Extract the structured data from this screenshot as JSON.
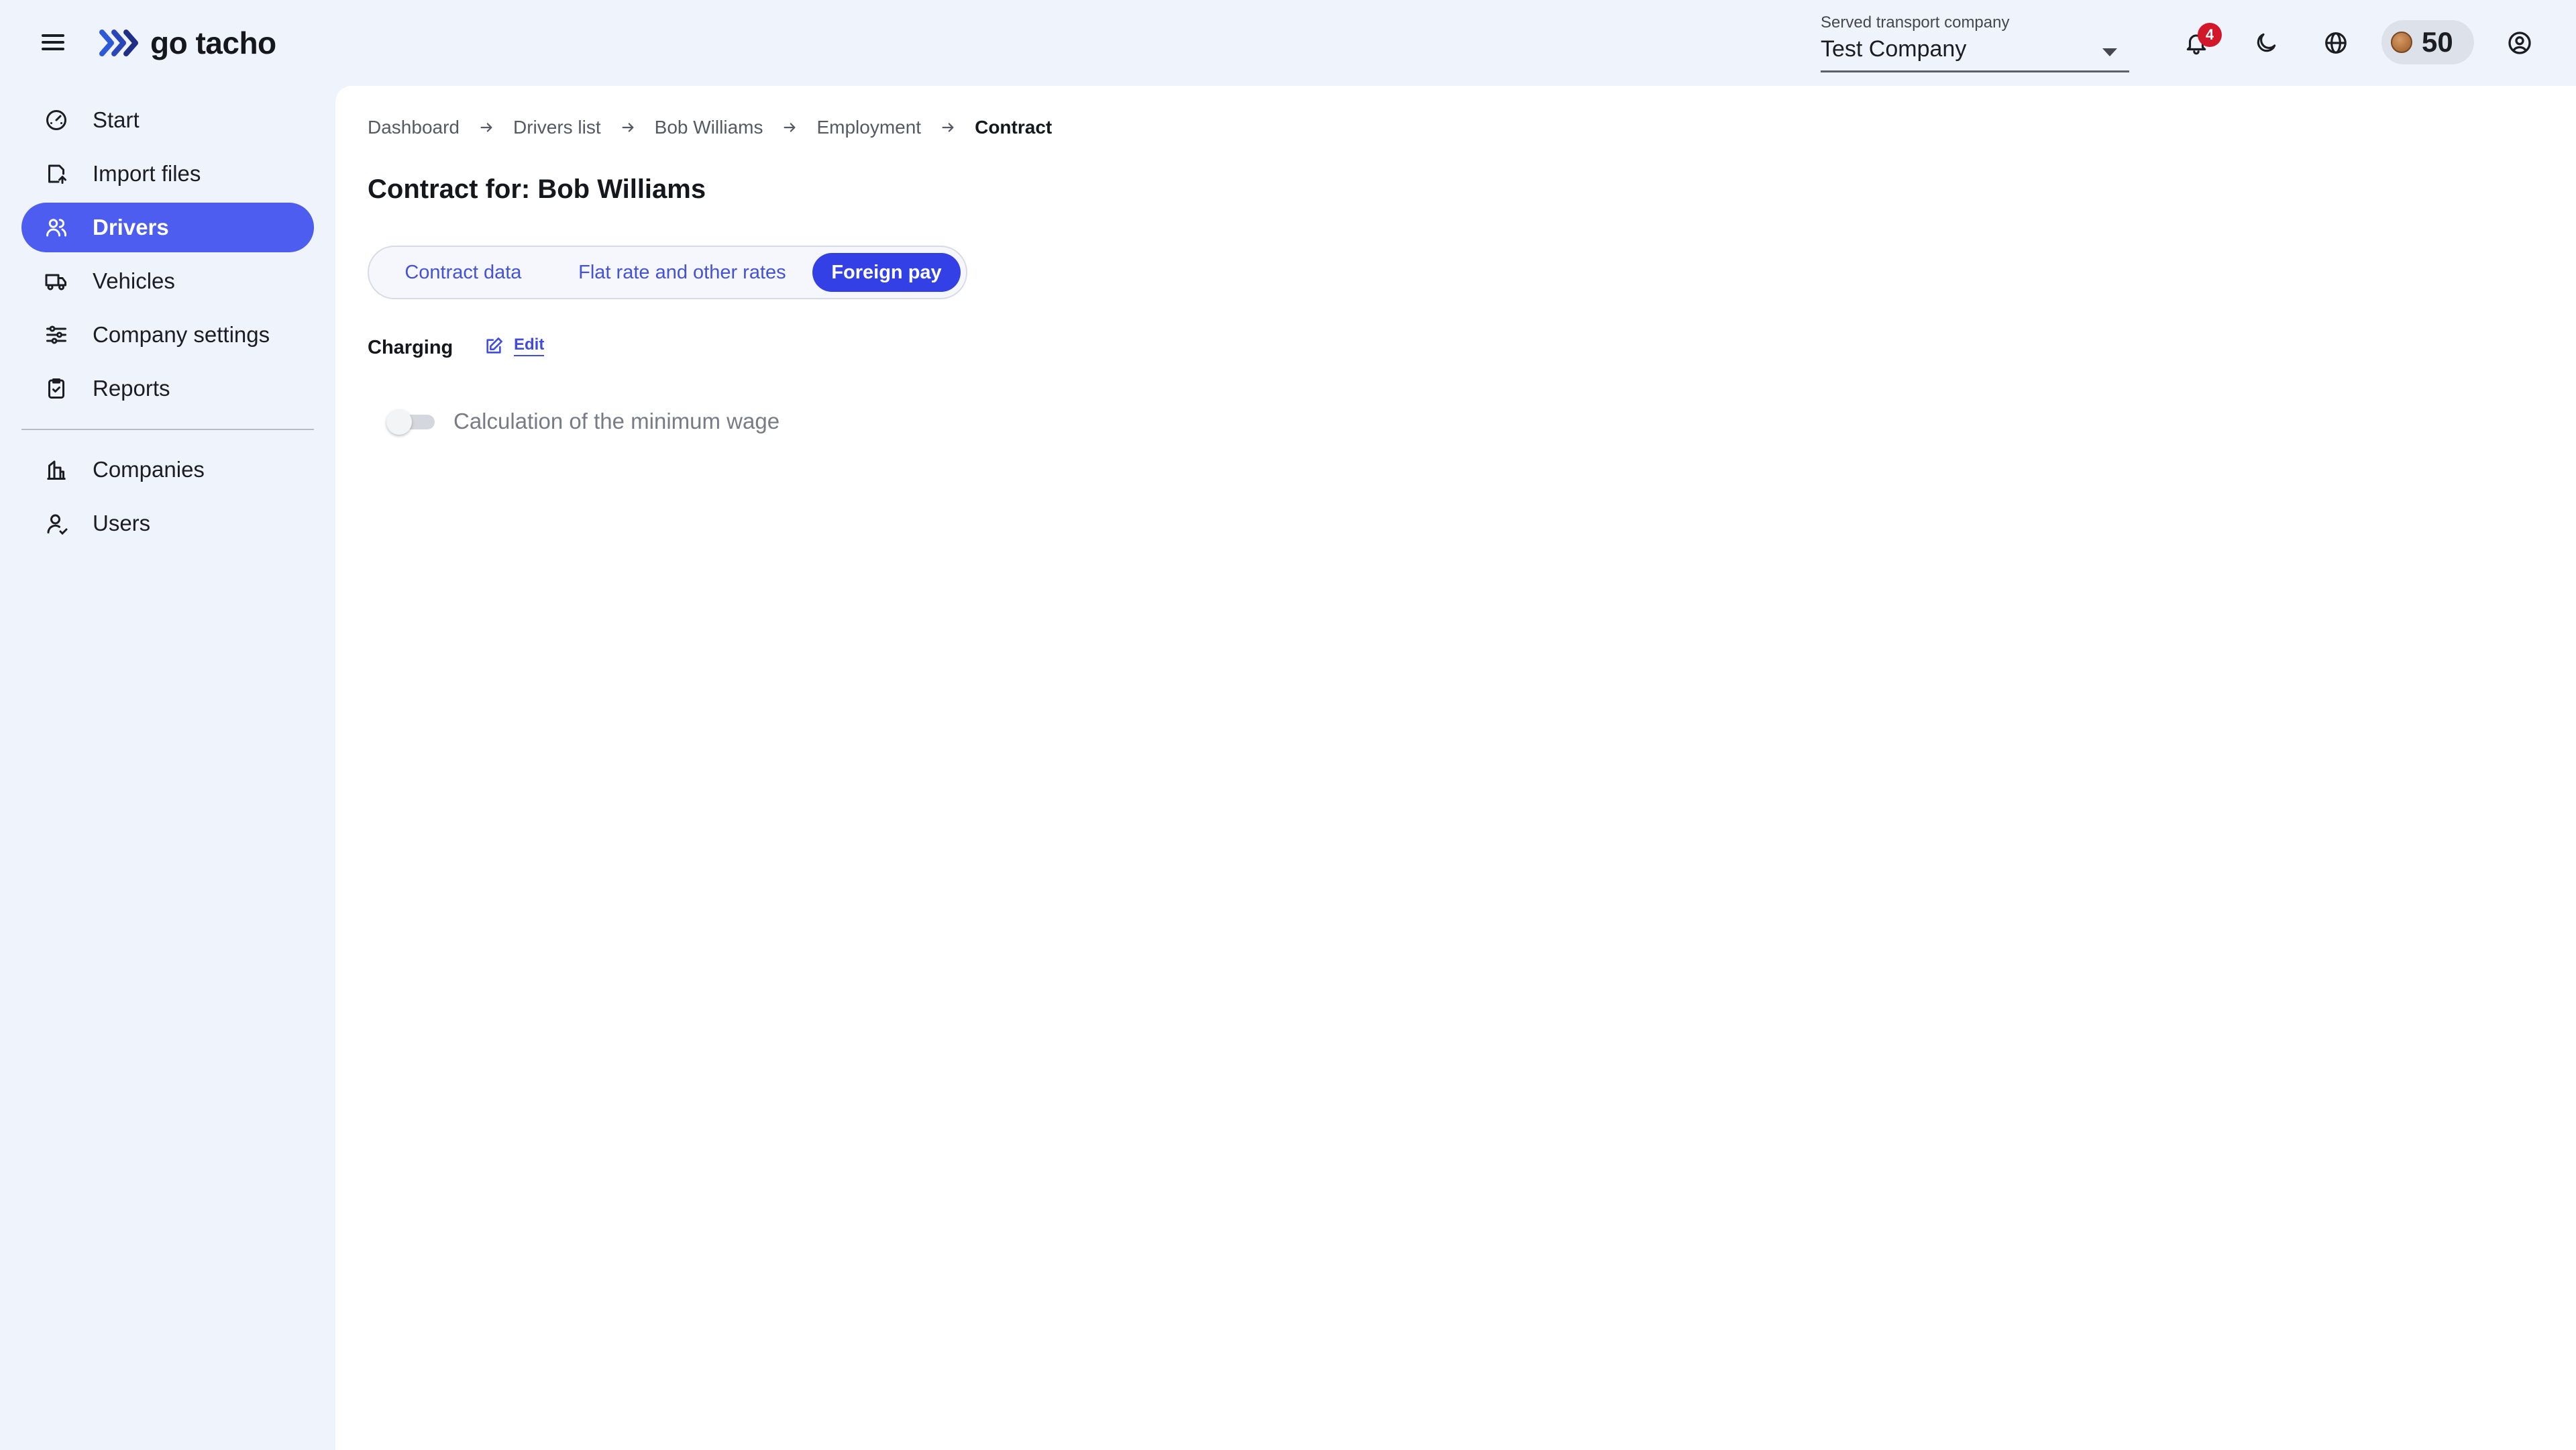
{
  "app": {
    "logo_text": "go tacho",
    "colors": {
      "accent": "#4c5df0",
      "tab_active": "#3340e6",
      "badge": "#d3172b",
      "link": "#3f4ce0"
    }
  },
  "header": {
    "company_select": {
      "label": "Served transport company",
      "value": "Test Company"
    },
    "notifications": {
      "icon": "bell-icon",
      "count": "4"
    },
    "theme_icon": "moon-icon",
    "language_icon": "globe-icon",
    "coins": {
      "icon": "coin-icon",
      "count": "50"
    },
    "account_icon": "user-circle-icon"
  },
  "sidebar": {
    "items": [
      {
        "label": "Start",
        "icon": "gauge-icon"
      },
      {
        "label": "Import files",
        "icon": "file-upload-icon"
      },
      {
        "label": "Drivers",
        "icon": "users-icon",
        "active": true
      },
      {
        "label": "Vehicles",
        "icon": "truck-icon"
      },
      {
        "label": "Company settings",
        "icon": "sliders-icon"
      },
      {
        "label": "Reports",
        "icon": "clipboard-icon"
      }
    ],
    "secondary_items": [
      {
        "label": "Companies",
        "icon": "building-icon"
      },
      {
        "label": "Users",
        "icon": "user-icon"
      }
    ]
  },
  "breadcrumb": [
    "Dashboard",
    "Drivers list",
    "Bob Williams",
    "Employment",
    "Contract"
  ],
  "page": {
    "title": "Contract for: Bob Williams",
    "tabs": [
      "Contract data",
      "Flat rate and other rates",
      "Foreign pay"
    ],
    "active_tab": "Foreign pay",
    "section": {
      "title": "Charging",
      "edit_label": "Edit"
    },
    "toggle": {
      "label": "Calculation of the minimum wage",
      "checked": false
    }
  }
}
